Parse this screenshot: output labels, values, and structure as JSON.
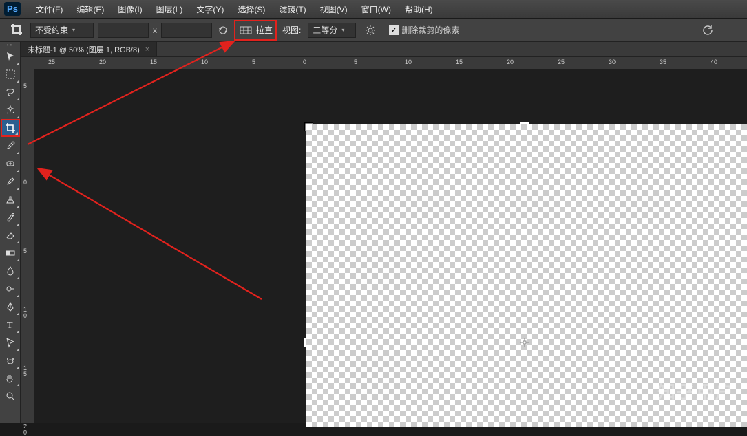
{
  "app_logo": "Ps",
  "menu": {
    "file": "文件(F)",
    "edit": "编辑(E)",
    "image": "图像(I)",
    "layer": "图层(L)",
    "type": "文字(Y)",
    "select": "选择(S)",
    "filter": "滤镜(T)",
    "view": "视图(V)",
    "window": "窗口(W)",
    "help": "帮助(H)"
  },
  "options": {
    "constraint": "不受约束",
    "x_sep": "x",
    "straighten": "拉直",
    "view_label": "视图:",
    "view_value": "三等分",
    "delete_crop": "删除裁剪的像素"
  },
  "tab": {
    "title": "未标题-1 @ 50% (图层 1, RGB/8)",
    "close": "×"
  },
  "ruler_h": [
    "25",
    "20",
    "15",
    "10",
    "5",
    "0",
    "5",
    "10",
    "15",
    "20",
    "25",
    "30",
    "35",
    "40"
  ],
  "ruler_v": [
    "5",
    "0",
    "5",
    "1\n0",
    "1\n5",
    "2\n0"
  ],
  "watermark": "知乎用户"
}
